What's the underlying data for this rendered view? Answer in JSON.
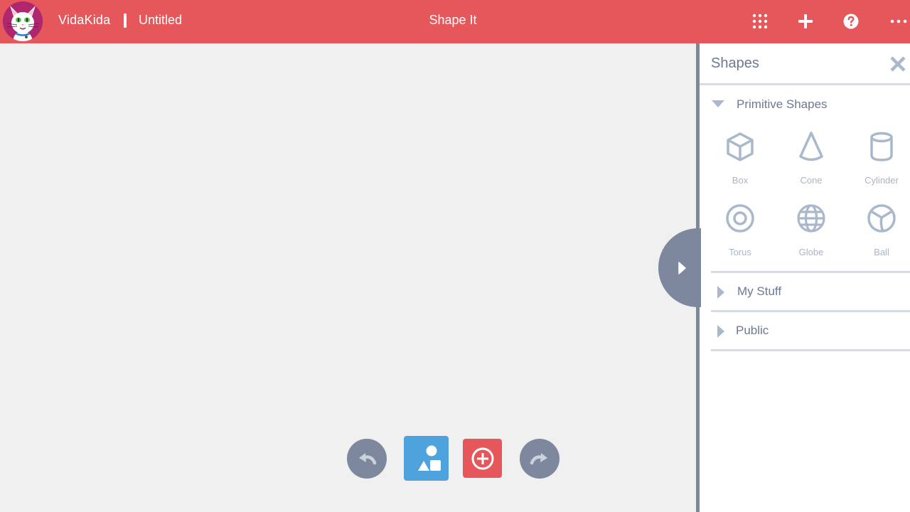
{
  "header": {
    "brand": "VidaKida",
    "document_title": "Untitled",
    "app_title": "Shape It",
    "buttons": [
      {
        "name": "apps-grid",
        "icon": "grid-icon"
      },
      {
        "name": "add",
        "icon": "plus-icon"
      },
      {
        "name": "help",
        "icon": "help-icon"
      },
      {
        "name": "more",
        "icon": "more-icon"
      }
    ]
  },
  "panel": {
    "title": "Shapes",
    "sections": [
      {
        "label": "Primitive Shapes",
        "expanded": true,
        "items": [
          {
            "label": "Box",
            "icon": "box-icon"
          },
          {
            "label": "Cone",
            "icon": "cone-icon"
          },
          {
            "label": "Cylinder",
            "icon": "cylinder-icon"
          },
          {
            "label": "Torus",
            "icon": "torus-icon"
          },
          {
            "label": "Globe",
            "icon": "globe-icon"
          },
          {
            "label": "Ball",
            "icon": "ball-icon"
          }
        ]
      },
      {
        "label": "My Stuff",
        "expanded": false
      },
      {
        "label": "Public",
        "expanded": false
      }
    ]
  },
  "toolbar": {
    "undo": "undo-icon",
    "shapes": "shapes-icon",
    "add": "add-circle-icon",
    "redo": "redo-icon"
  },
  "colors": {
    "header": "#e6575b",
    "panel_accent": "#7d889f",
    "shapes_button": "#4fa3dc",
    "add_button": "#e6575b",
    "icon_muted": "#aab8cc"
  }
}
